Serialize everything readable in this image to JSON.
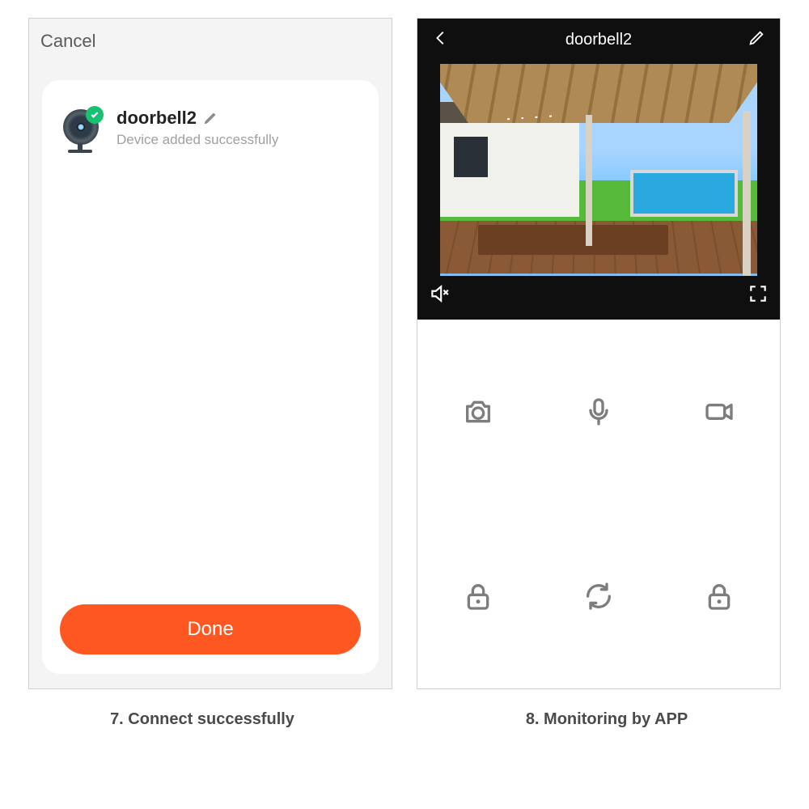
{
  "left": {
    "cancel": "Cancel",
    "device_name": "doorbell2",
    "device_status": "Device added successfully",
    "done": "Done"
  },
  "right": {
    "title": "doorbell2"
  },
  "captions": {
    "left": "7. Connect successfully",
    "right": "8. Monitoring by APP"
  }
}
